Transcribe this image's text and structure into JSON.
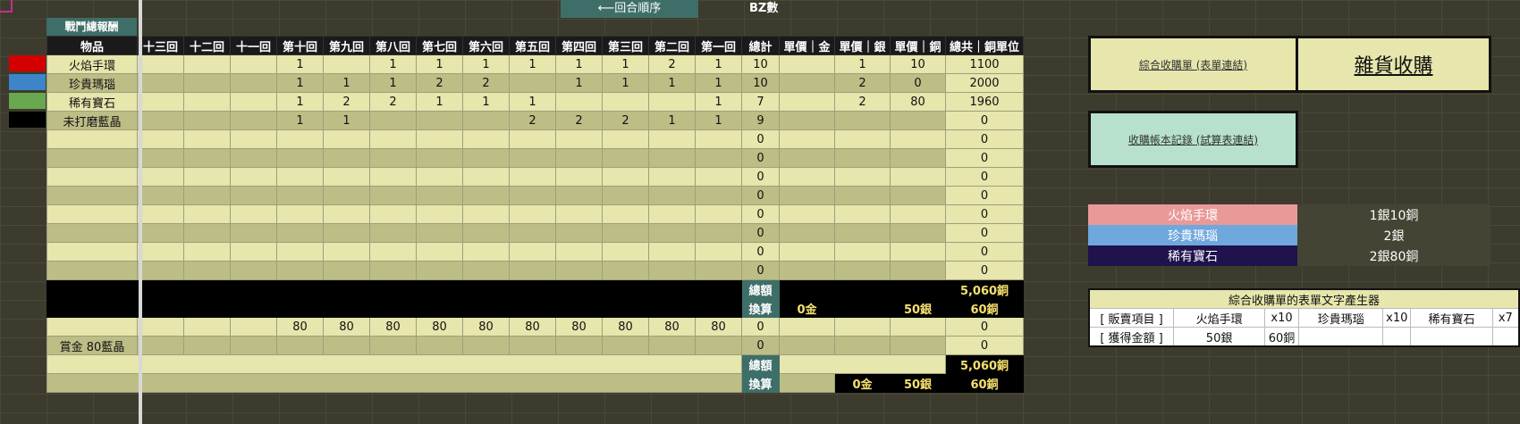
{
  "title_chip": "戰鬥總報酬",
  "round_order": "⟵回合順序",
  "bz_label": "BZ數",
  "headers": [
    "物品",
    "十三回",
    "十二回",
    "十一回",
    "第十回",
    "第九回",
    "第八回",
    "第七回",
    "第六回",
    "第五回",
    "第四回",
    "第三回",
    "第二回",
    "第一回",
    "總計",
    "單價｜金",
    "單價｜銀",
    "單價｜銅",
    "總共｜銅單位"
  ],
  "swatch_colors": [
    "#d40000",
    "#3d85c6",
    "#6aa84f",
    "#000000"
  ],
  "rows": [
    [
      "火焰手環",
      "",
      "",
      "",
      "1",
      "",
      "1",
      "1",
      "1",
      "1",
      "1",
      "1",
      "2",
      "1",
      "10",
      "",
      "1",
      "10",
      "1100"
    ],
    [
      "珍貴瑪瑙",
      "",
      "",
      "",
      "1",
      "1",
      "1",
      "2",
      "2",
      "",
      "1",
      "1",
      "1",
      "1",
      "10",
      "",
      "2",
      "0",
      "2000"
    ],
    [
      "稀有寶石",
      "",
      "",
      "",
      "1",
      "2",
      "2",
      "1",
      "1",
      "1",
      "",
      "",
      "",
      "1",
      "7",
      "",
      "2",
      "80",
      "1960"
    ],
    [
      "未打磨藍晶",
      "",
      "",
      "",
      "1",
      "1",
      "",
      "",
      "",
      "2",
      "2",
      "2",
      "1",
      "1",
      "9",
      "",
      "",
      "",
      "0"
    ],
    [
      "",
      "",
      "",
      "",
      "",
      "",
      "",
      "",
      "",
      "",
      "",
      "",
      "",
      "",
      "0",
      "",
      "",
      "",
      "0"
    ],
    [
      "",
      "",
      "",
      "",
      "",
      "",
      "",
      "",
      "",
      "",
      "",
      "",
      "",
      "",
      "0",
      "",
      "",
      "",
      "0"
    ],
    [
      "",
      "",
      "",
      "",
      "",
      "",
      "",
      "",
      "",
      "",
      "",
      "",
      "",
      "",
      "0",
      "",
      "",
      "",
      "0"
    ],
    [
      "",
      "",
      "",
      "",
      "",
      "",
      "",
      "",
      "",
      "",
      "",
      "",
      "",
      "",
      "0",
      "",
      "",
      "",
      "0"
    ],
    [
      "",
      "",
      "",
      "",
      "",
      "",
      "",
      "",
      "",
      "",
      "",
      "",
      "",
      "",
      "0",
      "",
      "",
      "",
      "0"
    ],
    [
      "",
      "",
      "",
      "",
      "",
      "",
      "",
      "",
      "",
      "",
      "",
      "",
      "",
      "",
      "0",
      "",
      "",
      "",
      "0"
    ],
    [
      "",
      "",
      "",
      "",
      "",
      "",
      "",
      "",
      "",
      "",
      "",
      "",
      "",
      "",
      "0",
      "",
      "",
      "",
      "0"
    ],
    [
      "",
      "",
      "",
      "",
      "",
      "",
      "",
      "",
      "",
      "",
      "",
      "",
      "",
      "",
      "0",
      "",
      "",
      "",
      "0"
    ]
  ],
  "summary1": {
    "total_label": "總額",
    "total_value": "5,060銅",
    "convert_label": "換算",
    "gold": "0金",
    "silver": "50銀",
    "copper": "60銅"
  },
  "bonus_rows": [
    [
      "",
      "",
      "",
      "",
      "80",
      "80",
      "80",
      "80",
      "80",
      "80",
      "80",
      "80",
      "80",
      "80",
      "0",
      "",
      "",
      "",
      "0"
    ],
    [
      "賞金 80藍晶",
      "",
      "",
      "",
      "",
      "",
      "",
      "",
      "",
      "",
      "",
      "",
      "",
      "",
      "0",
      "",
      "",
      "",
      "0"
    ]
  ],
  "summary2": {
    "total_label": "總額",
    "total_value": "5,060銅",
    "convert_label": "換算",
    "gold": "0金",
    "silver": "50銀",
    "copper": "60銅"
  },
  "buttons": {
    "combined_link": "綜合收購單 (表單連結)",
    "grocery_title": "雜貨收購",
    "ledger_link": "收購帳本記錄 (試算表連結)"
  },
  "prices": [
    {
      "name": "火焰手環",
      "value": "1銀10銅",
      "color": "#ea9999"
    },
    {
      "name": "珍貴瑪瑙",
      "value": "2銀",
      "color": "#6fa8dc"
    },
    {
      "name": "稀有寶石",
      "value": "2銀80銅",
      "color": "#20124d"
    }
  ],
  "generator": {
    "title": "綜合收購單的表單文字產生器",
    "row1": [
      "[ 販賣項目 ]",
      "火焰手環",
      "x10",
      "珍貴瑪瑙",
      "x10",
      "稀有寶石",
      "x7"
    ],
    "row2": [
      "[ 獲得金額 ]",
      "50銀",
      "60銅",
      "",
      "",
      "",
      ""
    ]
  }
}
